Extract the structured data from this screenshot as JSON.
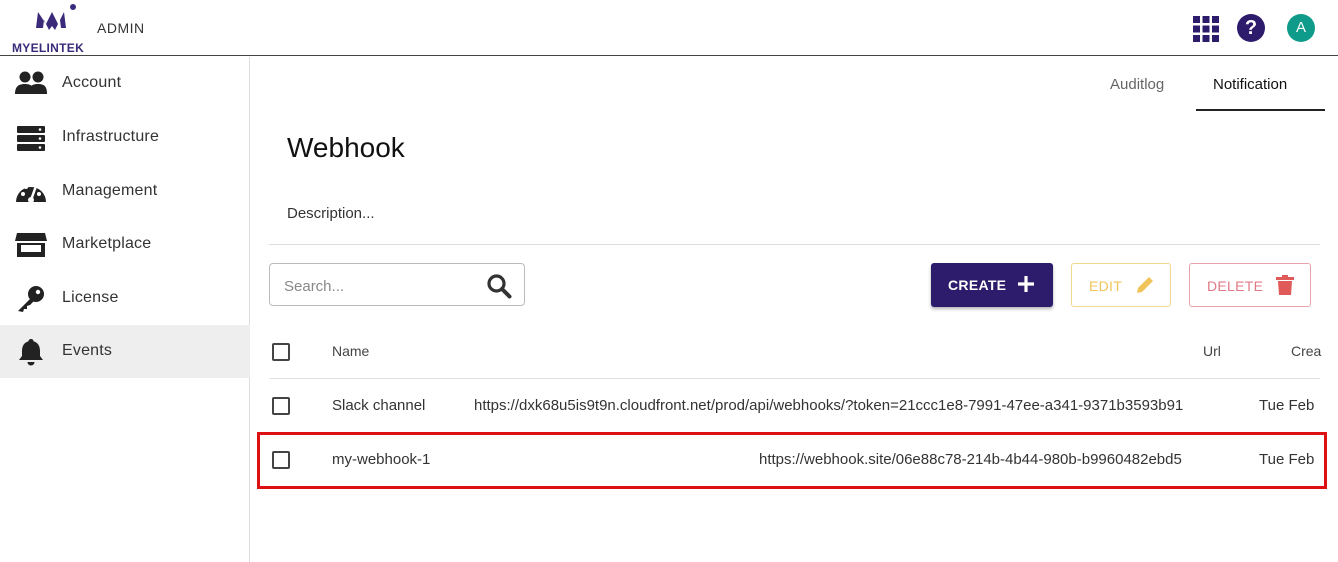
{
  "header": {
    "brand": "MYELINTEK",
    "admin_label": "ADMIN",
    "avatar_letter": "A",
    "help_symbol": "?"
  },
  "sidebar": {
    "items": [
      {
        "label": "Account",
        "icon": "users-icon"
      },
      {
        "label": "Infrastructure",
        "icon": "server-icon"
      },
      {
        "label": "Management",
        "icon": "gauge-icon"
      },
      {
        "label": "Marketplace",
        "icon": "store-icon"
      },
      {
        "label": "License",
        "icon": "key-icon"
      },
      {
        "label": "Events",
        "icon": "bell-icon",
        "active": true
      }
    ]
  },
  "tabs": [
    {
      "label": "Auditlog",
      "active": false
    },
    {
      "label": "Notification",
      "active": true
    }
  ],
  "main": {
    "title": "Webhook",
    "description": "Description...",
    "search_placeholder": "Search...",
    "buttons": {
      "create": "CREATE",
      "edit": "EDIT",
      "delete": "DELETE"
    }
  },
  "table": {
    "columns": [
      "Name",
      "Url",
      "Crea"
    ],
    "rows": [
      {
        "name": "Slack channel",
        "url": "https://dxk68u5is9t9n.cloudfront.net/prod/api/webhooks/?token=21ccc1e8-7991-47ee-a341-9371b3593b91",
        "created": "Tue Feb"
      },
      {
        "name": "my-webhook-1",
        "url": "https://webhook.site/06e88c78-214b-4b44-980b-b9960482ebd5",
        "created": "Tue Feb",
        "highlighted": true
      }
    ]
  },
  "colors": {
    "primary": "#2d1c6b",
    "avatar": "#0e9b8a",
    "edit": "#f1c45a",
    "delete": "#e07a86",
    "highlight": "#dd1111",
    "delete_icon": "#e05a5a"
  }
}
